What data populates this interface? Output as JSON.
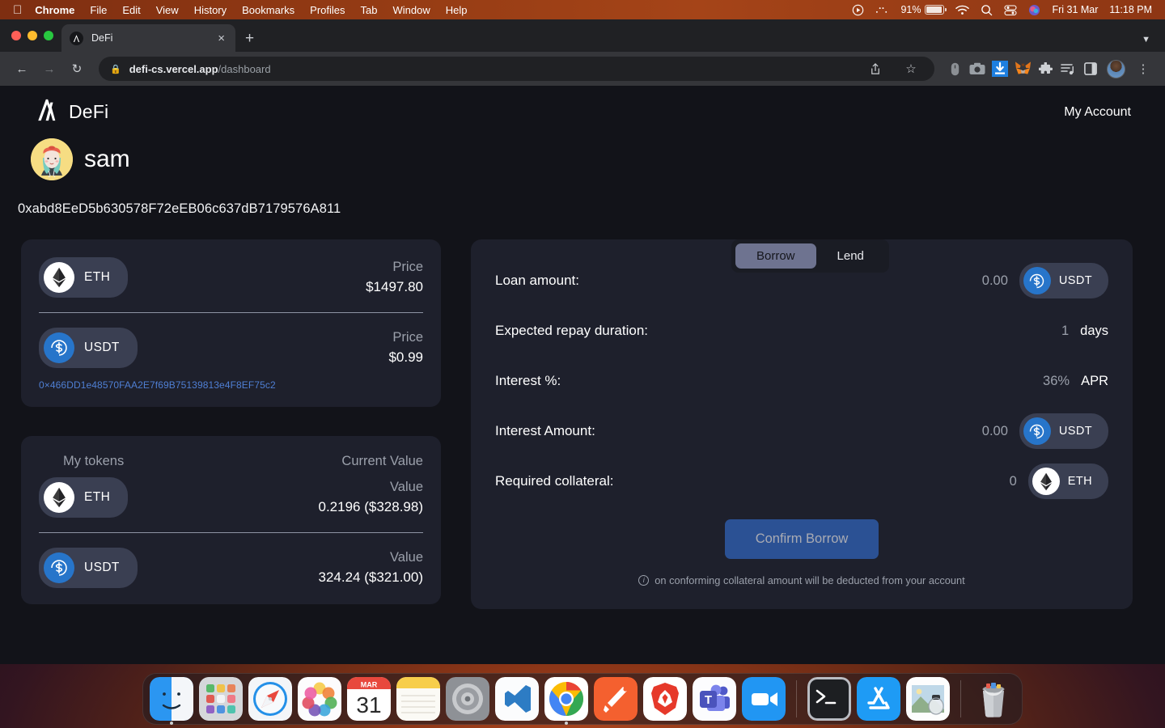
{
  "menubar": {
    "apple": "apple-logo",
    "items": [
      "Chrome",
      "File",
      "Edit",
      "View",
      "History",
      "Bookmarks",
      "Profiles",
      "Tab",
      "Window",
      "Help"
    ],
    "status": {
      "battery_percent": "91%",
      "date": "Fri 31 Mar",
      "time": "11:18 PM"
    }
  },
  "browser": {
    "tab_title": "DeFi",
    "url_host": "defi-cs.vercel.app",
    "url_path": "/dashboard",
    "new_tab_label": "+",
    "close_label": "×"
  },
  "app": {
    "brand": "DeFi",
    "my_account": "My Account",
    "user": {
      "name": "sam",
      "wallet_address": "0xabd8EeD5b630578F72eEB06c637dB7179576A811"
    },
    "mode_toggle": {
      "options": [
        "Borrow",
        "Lend"
      ],
      "active": "Borrow"
    },
    "price_card": {
      "rows": [
        {
          "token": "ETH",
          "icon": "eth-coin-icon",
          "label": "Price",
          "value": "$1497.80"
        },
        {
          "token": "USDT",
          "icon": "usdt-coin-icon",
          "label": "Price",
          "value": "$0.99"
        }
      ],
      "contract_address": "0×466DD1e48570FAA2E7f69B75139813e4F8EF75c2"
    },
    "tokens_card": {
      "header_left": "My tokens",
      "header_right": "Current Value",
      "rows": [
        {
          "token": "ETH",
          "icon": "eth-coin-icon",
          "label": "Value",
          "value": "0.2196 ($328.98)"
        },
        {
          "token": "USDT",
          "icon": "usdt-coin-icon",
          "label": "Value",
          "value": "324.24 ($321.00)"
        }
      ]
    },
    "borrow_panel": {
      "rows": [
        {
          "label": "Loan amount:",
          "value": "0.00",
          "unit": "",
          "token": "USDT",
          "icon": "usdt-coin-icon"
        },
        {
          "label": "Expected repay duration:",
          "value": "1",
          "unit": "days",
          "token": "",
          "icon": ""
        },
        {
          "label": "Interest %:",
          "value": "36%",
          "unit": "APR",
          "token": "",
          "icon": ""
        },
        {
          "label": "Interest Amount:",
          "value": "0.00",
          "unit": "",
          "token": "USDT",
          "icon": "usdt-coin-icon"
        },
        {
          "label": "Required collateral:",
          "value": "0",
          "unit": "",
          "token": "ETH",
          "icon": "eth-coin-icon"
        }
      ],
      "confirm_label": "Confirm Borrow",
      "note": "on conforming collateral amount will be deducted from your account"
    }
  },
  "colors": {
    "page_bg": "#121319",
    "card_bg": "#1e202c",
    "pill_bg": "#3a3f52",
    "accent_blue": "#2b5194",
    "link_blue": "#4f7fd4",
    "usdt_blue": "#2775ca",
    "muted_text": "#9ba0ab",
    "toggle_active": "#6e7390"
  },
  "dock": {
    "items": [
      {
        "name": "finder",
        "running": true
      },
      {
        "name": "launchpad",
        "running": false
      },
      {
        "name": "safari",
        "running": false
      },
      {
        "name": "photos",
        "running": false
      },
      {
        "name": "calendar",
        "running": false,
        "month": "MAR",
        "day": "31"
      },
      {
        "name": "notes",
        "running": false
      },
      {
        "name": "system-preferences",
        "running": false
      },
      {
        "name": "visual-studio-code",
        "running": false
      },
      {
        "name": "google-chrome",
        "running": true
      },
      {
        "name": "sublime-text",
        "running": false
      },
      {
        "name": "brave-browser",
        "running": false
      },
      {
        "name": "microsoft-teams",
        "running": false
      },
      {
        "name": "zoom",
        "running": false
      },
      {
        "name": "terminal",
        "running": false
      },
      {
        "name": "app-store",
        "running": false
      },
      {
        "name": "preview",
        "running": false
      },
      {
        "name": "trash",
        "running": false
      }
    ]
  }
}
